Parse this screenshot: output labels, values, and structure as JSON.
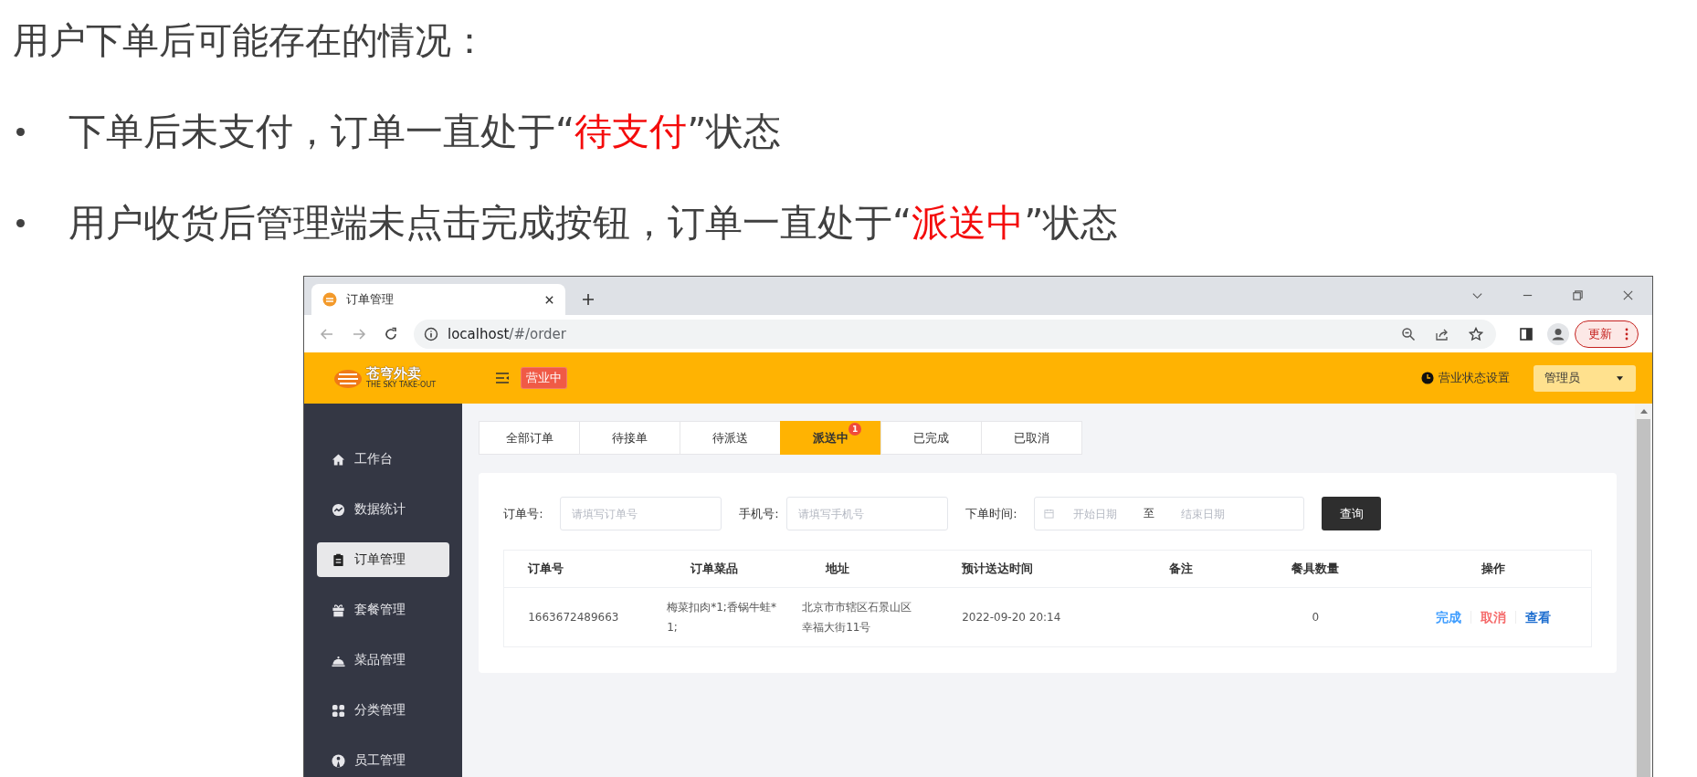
{
  "slide": {
    "title": "用户下单后可能存在的情况：",
    "bullets": [
      {
        "parts": [
          {
            "text": "下单后未支付，订单一直处于“",
            "highlight": false
          },
          {
            "text": "待支付",
            "highlight": true
          },
          {
            "text": "”状态",
            "highlight": false
          }
        ]
      },
      {
        "parts": [
          {
            "text": "用户收货后管理端未点击完成按钮，订单一直处于“",
            "highlight": false
          },
          {
            "text": "派送中",
            "highlight": true
          },
          {
            "text": "”状态",
            "highlight": false
          }
        ]
      }
    ]
  },
  "browser": {
    "tab_title": "订单管理",
    "url_host": "localhost",
    "url_path": "/#/order",
    "update_button": "更新"
  },
  "app": {
    "logo": {
      "name": "苍穹外卖",
      "tagline": "THE SKY TAKE-OUT"
    },
    "status_badge": "营业中",
    "status_setting": "营业状态设置",
    "user_menu": "管理员",
    "sidebar": [
      {
        "label": "工作台",
        "selected": false
      },
      {
        "label": "数据统计",
        "selected": false
      },
      {
        "label": "订单管理",
        "selected": true
      },
      {
        "label": "套餐管理",
        "selected": false
      },
      {
        "label": "菜品管理",
        "selected": false
      },
      {
        "label": "分类管理",
        "selected": false
      },
      {
        "label": "员工管理",
        "selected": false
      }
    ],
    "order_tabs": [
      {
        "label": "全部订单",
        "selected": false
      },
      {
        "label": "待接单",
        "selected": false
      },
      {
        "label": "待派送",
        "selected": false
      },
      {
        "label": "派送中",
        "selected": true,
        "badge": "1"
      },
      {
        "label": "已完成",
        "selected": false
      },
      {
        "label": "已取消",
        "selected": false
      }
    ],
    "filters": [
      {
        "label": "订单号:",
        "placeholder": "请填写订单号"
      },
      {
        "label": "手机号:",
        "placeholder": "请填写手机号"
      }
    ],
    "date_range": {
      "label": "下单时间:",
      "start_placeholder": "开始日期",
      "separator": "至",
      "end_placeholder": "结束日期"
    },
    "query_button": "查询",
    "table": {
      "columns": [
        "订单号",
        "订单菜品",
        "地址",
        "预计送达时间",
        "备注",
        "餐具数量",
        "操作"
      ],
      "rows": [
        {
          "order_no": "1663672489663",
          "dishes": "梅菜扣肉*1;香锅牛蛙*1;",
          "address": "北京市市辖区石景山区幸福大街11号",
          "delivery_time": "2022-09-20 20:14",
          "tableware": "0",
          "actions": [
            {
              "label": "完成",
              "color": "#409eff"
            },
            {
              "label": "取消",
              "color": "#f56c6c"
            },
            {
              "label": "查看",
              "color": "#1f6fd0"
            }
          ]
        }
      ]
    }
  }
}
